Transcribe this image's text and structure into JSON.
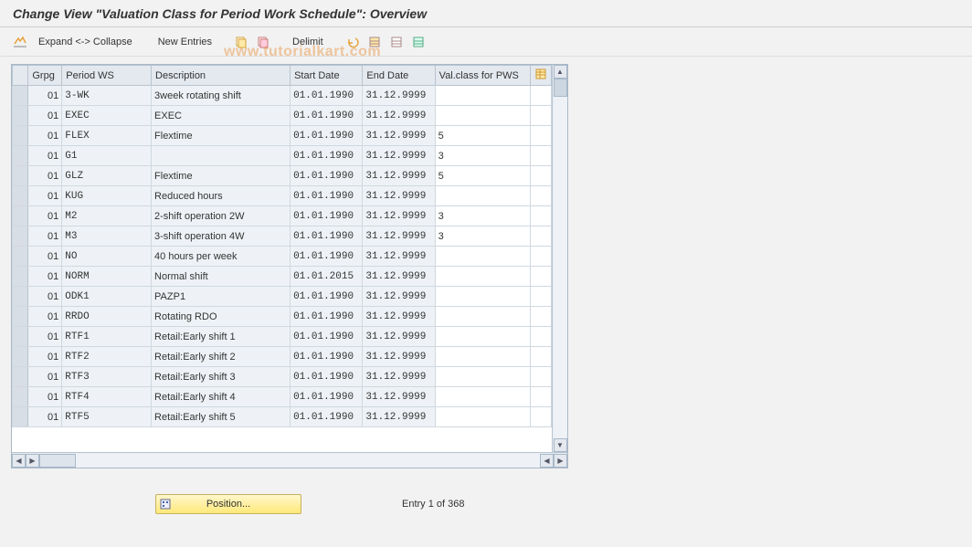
{
  "title": "Change View \"Valuation Class for Period Work Schedule\": Overview",
  "watermark": "www.tutorialkart.com",
  "toolbar": {
    "expand_collapse": "Expand <-> Collapse",
    "new_entries": "New Entries",
    "delimit": "Delimit"
  },
  "columns": {
    "sel": "",
    "grpg": "Grpg",
    "period_ws": "Period WS",
    "description": "Description",
    "start_date": "Start Date",
    "end_date": "End Date",
    "val_class": "Val.class for PWS"
  },
  "rows": [
    {
      "grpg": "01",
      "pws": "3-WK",
      "desc": "3week rotating shift",
      "start": "01.01.1990",
      "end": "31.12.9999",
      "val": ""
    },
    {
      "grpg": "01",
      "pws": "EXEC",
      "desc": "EXEC",
      "start": "01.01.1990",
      "end": "31.12.9999",
      "val": ""
    },
    {
      "grpg": "01",
      "pws": "FLEX",
      "desc": "Flextime",
      "start": "01.01.1990",
      "end": "31.12.9999",
      "val": "5"
    },
    {
      "grpg": "01",
      "pws": "G1",
      "desc": "",
      "start": "01.01.1990",
      "end": "31.12.9999",
      "val": "3"
    },
    {
      "grpg": "01",
      "pws": "GLZ",
      "desc": "Flextime",
      "start": "01.01.1990",
      "end": "31.12.9999",
      "val": "5"
    },
    {
      "grpg": "01",
      "pws": "KUG",
      "desc": "Reduced hours",
      "start": "01.01.1990",
      "end": "31.12.9999",
      "val": ""
    },
    {
      "grpg": "01",
      "pws": "M2",
      "desc": "2-shift operation 2W",
      "start": "01.01.1990",
      "end": "31.12.9999",
      "val": "3"
    },
    {
      "grpg": "01",
      "pws": "M3",
      "desc": "3-shift operation 4W",
      "start": "01.01.1990",
      "end": "31.12.9999",
      "val": "3"
    },
    {
      "grpg": "01",
      "pws": "NO",
      "desc": "40 hours per week",
      "start": "01.01.1990",
      "end": "31.12.9999",
      "val": ""
    },
    {
      "grpg": "01",
      "pws": "NORM",
      "desc": "Normal shift",
      "start": "01.01.2015",
      "end": "31.12.9999",
      "val": ""
    },
    {
      "grpg": "01",
      "pws": "ODK1",
      "desc": "PAZP1",
      "start": "01.01.1990",
      "end": "31.12.9999",
      "val": ""
    },
    {
      "grpg": "01",
      "pws": "RRDO",
      "desc": "Rotating RDO",
      "start": "01.01.1990",
      "end": "31.12.9999",
      "val": ""
    },
    {
      "grpg": "01",
      "pws": "RTF1",
      "desc": "Retail:Early shift 1",
      "start": "01.01.1990",
      "end": "31.12.9999",
      "val": ""
    },
    {
      "grpg": "01",
      "pws": "RTF2",
      "desc": "Retail:Early shift 2",
      "start": "01.01.1990",
      "end": "31.12.9999",
      "val": ""
    },
    {
      "grpg": "01",
      "pws": "RTF3",
      "desc": "Retail:Early shift 3",
      "start": "01.01.1990",
      "end": "31.12.9999",
      "val": ""
    },
    {
      "grpg": "01",
      "pws": "RTF4",
      "desc": "Retail:Early shift 4",
      "start": "01.01.1990",
      "end": "31.12.9999",
      "val": ""
    },
    {
      "grpg": "01",
      "pws": "RTF5",
      "desc": "Retail:Early shift 5",
      "start": "01.01.1990",
      "end": "31.12.9999",
      "val": ""
    }
  ],
  "footer": {
    "position_label": "Position...",
    "entry_text": "Entry 1 of 368"
  }
}
